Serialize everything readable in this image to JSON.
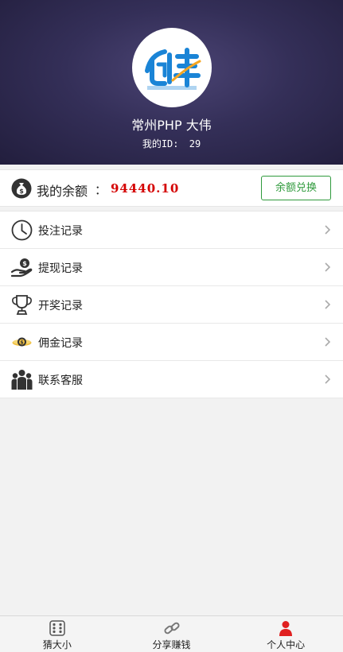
{
  "header": {
    "username": "常州PHP 大伟",
    "id_label": "我的ID:",
    "id_value": "29"
  },
  "balance": {
    "label": "我的余额",
    "colon": "：",
    "value": "94440.10",
    "exchange_button": "余额兑换"
  },
  "menu": {
    "items": [
      {
        "label": "投注记录",
        "icon": "clock-icon"
      },
      {
        "label": "提现记录",
        "icon": "money-hand-icon"
      },
      {
        "label": "开奖记录",
        "icon": "trophy-icon"
      },
      {
        "label": "佣金记录",
        "icon": "coin-icon"
      },
      {
        "label": "联系客服",
        "icon": "people-icon"
      }
    ]
  },
  "tabbar": {
    "tabs": [
      {
        "label": "猜大小",
        "icon": "dice-icon"
      },
      {
        "label": "分享赚钱",
        "icon": "link-icon"
      },
      {
        "label": "个人中心",
        "icon": "person-icon",
        "active": true
      }
    ]
  },
  "colors": {
    "header_bg": "#2e2a50",
    "balance_value": "#d40000",
    "accent_green": "#2f9a3c",
    "active_tab": "#e02020"
  }
}
